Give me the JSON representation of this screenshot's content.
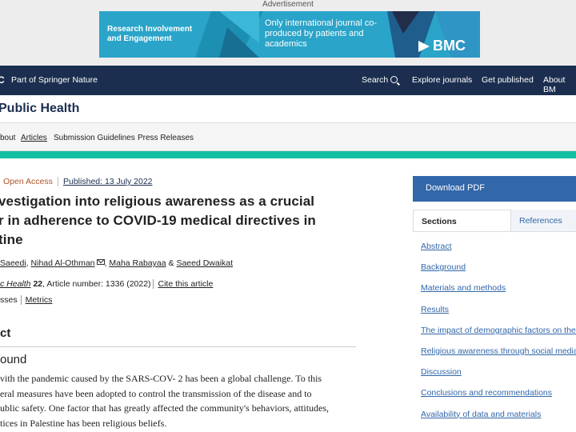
{
  "ad": {
    "label": "Advertisement",
    "left_text": "Research Involvement and Engagement",
    "mid_text": "Only international journal co-produced by patients and academics",
    "logo": "BMC",
    "logo_icon": "bmc-triangle-icon"
  },
  "header": {
    "brand_fragment": "C",
    "brand": "Part of Springer Nature",
    "search_label": "Search",
    "search_icon": "magnifier-icon",
    "explore": "Explore journals",
    "get_published": "Get published",
    "about": "About BM"
  },
  "journal": {
    "title": "Public Health"
  },
  "journal_nav": {
    "about": "bout",
    "articles": "Articles",
    "submission": "Submission Guidelines",
    "press": "Press Releases"
  },
  "article": {
    "open_access": "Open Access",
    "published": "Published: 13 July 2022",
    "title_line1": "vestigation into religious awareness as a crucial",
    "title_line2": "r in adherence to COVID-19 medical directives in",
    "title_line3": "tine",
    "authors": [
      "Saeedi",
      "Nihad Al-Othman",
      "Maha Rabayaa",
      "Saeed Dwaikat"
    ],
    "author_sep": ",",
    "author_and": "&",
    "journal_ref": "c Health",
    "volume": "22",
    "article_number": ", Article number: 1336 (2022)",
    "cite": "Cite this article",
    "accesses": "sses",
    "metrics": "Metrics"
  },
  "content": {
    "section": "ct",
    "subsection": "ound",
    "body": [
      "vith the pandemic caused by the SARS-COV- 2 has been a global challenge. To this",
      "eral measures have been adopted to control the transmission of the disease and to",
      "ublic safety. One factor that has greatly affected the community's behaviors, attitudes,",
      "tices in Palestine has been religious beliefs."
    ]
  },
  "sidebar": {
    "download": "Download PDF",
    "tab_sections": "Sections",
    "tab_references": "References",
    "toc": [
      "Abstract",
      "Background",
      "Materials and methods",
      "Results",
      "The impact of demographic factors on the r",
      "Religious awareness through social media, c",
      "Discussion",
      "Conclusions and recommendations",
      "Availability of data and materials"
    ]
  },
  "colors": {
    "navy": "#1b2e4f",
    "teal": "#14c0a2",
    "link": "#3267a9",
    "open_access": "#b2532a",
    "ad_bg": "#2aa4c8"
  }
}
